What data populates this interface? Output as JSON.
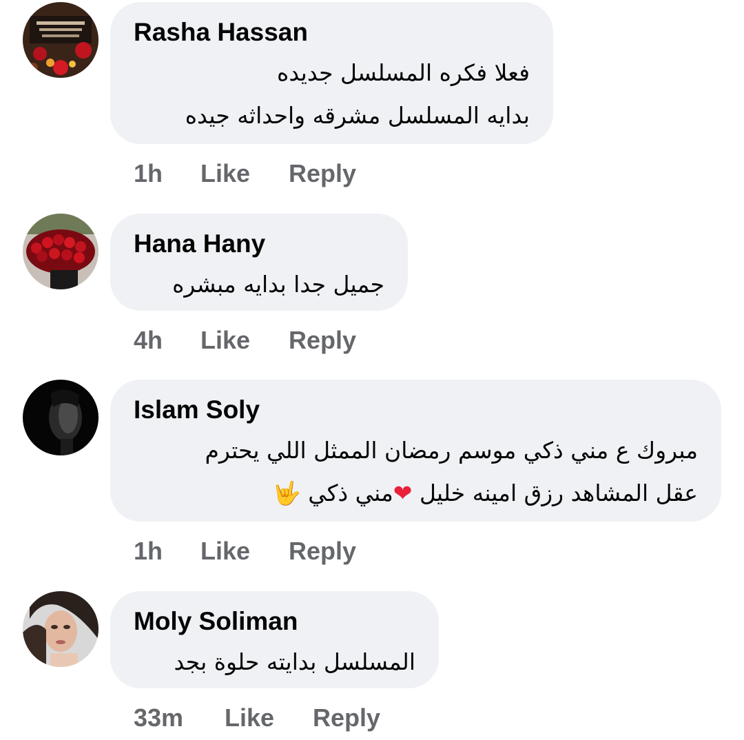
{
  "comments": [
    {
      "name": "Rasha Hassan",
      "lines": [
        "فعلا فكره المسلسل جديده",
        "بدايه المسلسل مشرقه واحداثه جيده"
      ],
      "time": "1h",
      "like": "Like",
      "reply": "Reply",
      "avatar_icon": "rose-candle-avatar"
    },
    {
      "name": "Hana Hany",
      "lines": [
        "جميل جدا بدايه مبشره"
      ],
      "time": "4h",
      "like": "Like",
      "reply": "Reply",
      "avatar_icon": "red-roses-bouquet-avatar"
    },
    {
      "name": "Islam Soly",
      "lines": [
        "مبروك ع مني ذكي موسم رمضان الممثل اللي يحترم",
        "عقل المشاهد رزق امينه خليل",
        "مني ذكي"
      ],
      "time": "1h",
      "like": "Like",
      "reply": "Reply",
      "avatar_icon": "dark-portrait-avatar",
      "emojis": [
        "❤",
        "🤟"
      ]
    },
    {
      "name": "Moly Soliman",
      "lines": [
        "المسلسل بدايته حلوة بجد"
      ],
      "time": "33m",
      "like": "Like",
      "reply": "Reply",
      "avatar_icon": "woman-portrait-avatar"
    }
  ],
  "colors": {
    "bubble": "#eff1f4",
    "name": "#050505",
    "meta": "#65676b",
    "heart": "#e8203a"
  }
}
